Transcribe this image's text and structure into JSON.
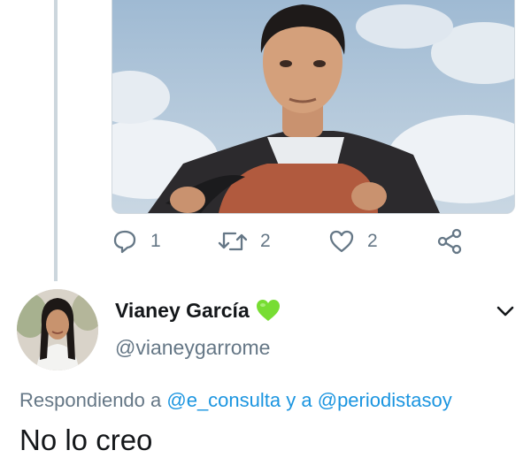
{
  "colors": {
    "link": "#1b95e0",
    "secondary_text": "#657786",
    "primary_text": "#14171a",
    "heart_badge": "#77dd33",
    "thread_line": "#ccd6dd"
  },
  "previous_tweet": {
    "media": {
      "description_icon": "image"
    },
    "actions": {
      "reply": {
        "icon": "reply-icon",
        "count": "1"
      },
      "retweet": {
        "icon": "retweet-icon",
        "count": "2"
      },
      "like": {
        "icon": "heart-outline-icon",
        "count": "2"
      },
      "share": {
        "icon": "share-icon"
      }
    }
  },
  "reply_tweet": {
    "author": {
      "display_name": "Vianey García",
      "name_badge": "green-heart-emoji",
      "handle": "@vianeygarrome"
    },
    "menu_icon": "chevron-down-icon",
    "replying_to": {
      "prefix": "Respondiendo a",
      "mention_1": "@e_consulta",
      "connector": "y a",
      "mention_2": "@periodistasoy"
    },
    "text": "No lo creo"
  }
}
